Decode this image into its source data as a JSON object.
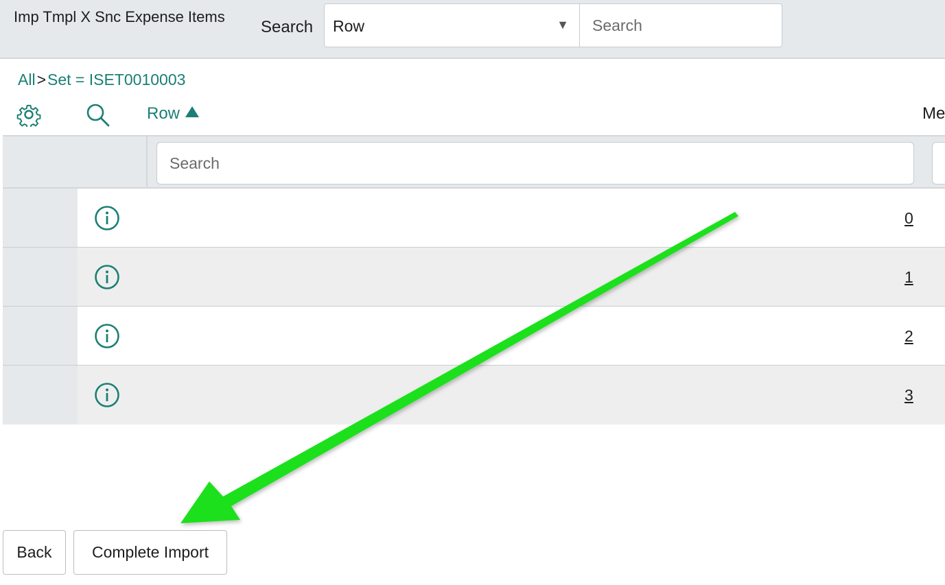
{
  "header": {
    "title": "Imp Tmpl X Snc Expense Items",
    "search_label": "Search",
    "field_value": "Row",
    "search_placeholder": "Search"
  },
  "breadcrumb": {
    "all": "All",
    "separator": ">",
    "filter": "Set = ISET0010003"
  },
  "table": {
    "columns": [
      {
        "label": "Row",
        "sort": "ascending"
      },
      {
        "label": "Mes"
      }
    ],
    "column_search_placeholder": "Search",
    "rows": [
      {
        "row": "0"
      },
      {
        "row": "1"
      },
      {
        "row": "2"
      },
      {
        "row": "3"
      }
    ]
  },
  "buttons": {
    "back": "Back",
    "complete_import": "Complete Import"
  },
  "colors": {
    "accent": "#1a7f74",
    "header_bg": "#e6e9ec",
    "annotation_arrow": "#1fe01f"
  },
  "icons": {
    "settings": "gear-icon",
    "search": "search-icon",
    "row_info": "info-icon",
    "dropdown": "caret-down-icon",
    "sort": "sort-ascending-icon"
  }
}
